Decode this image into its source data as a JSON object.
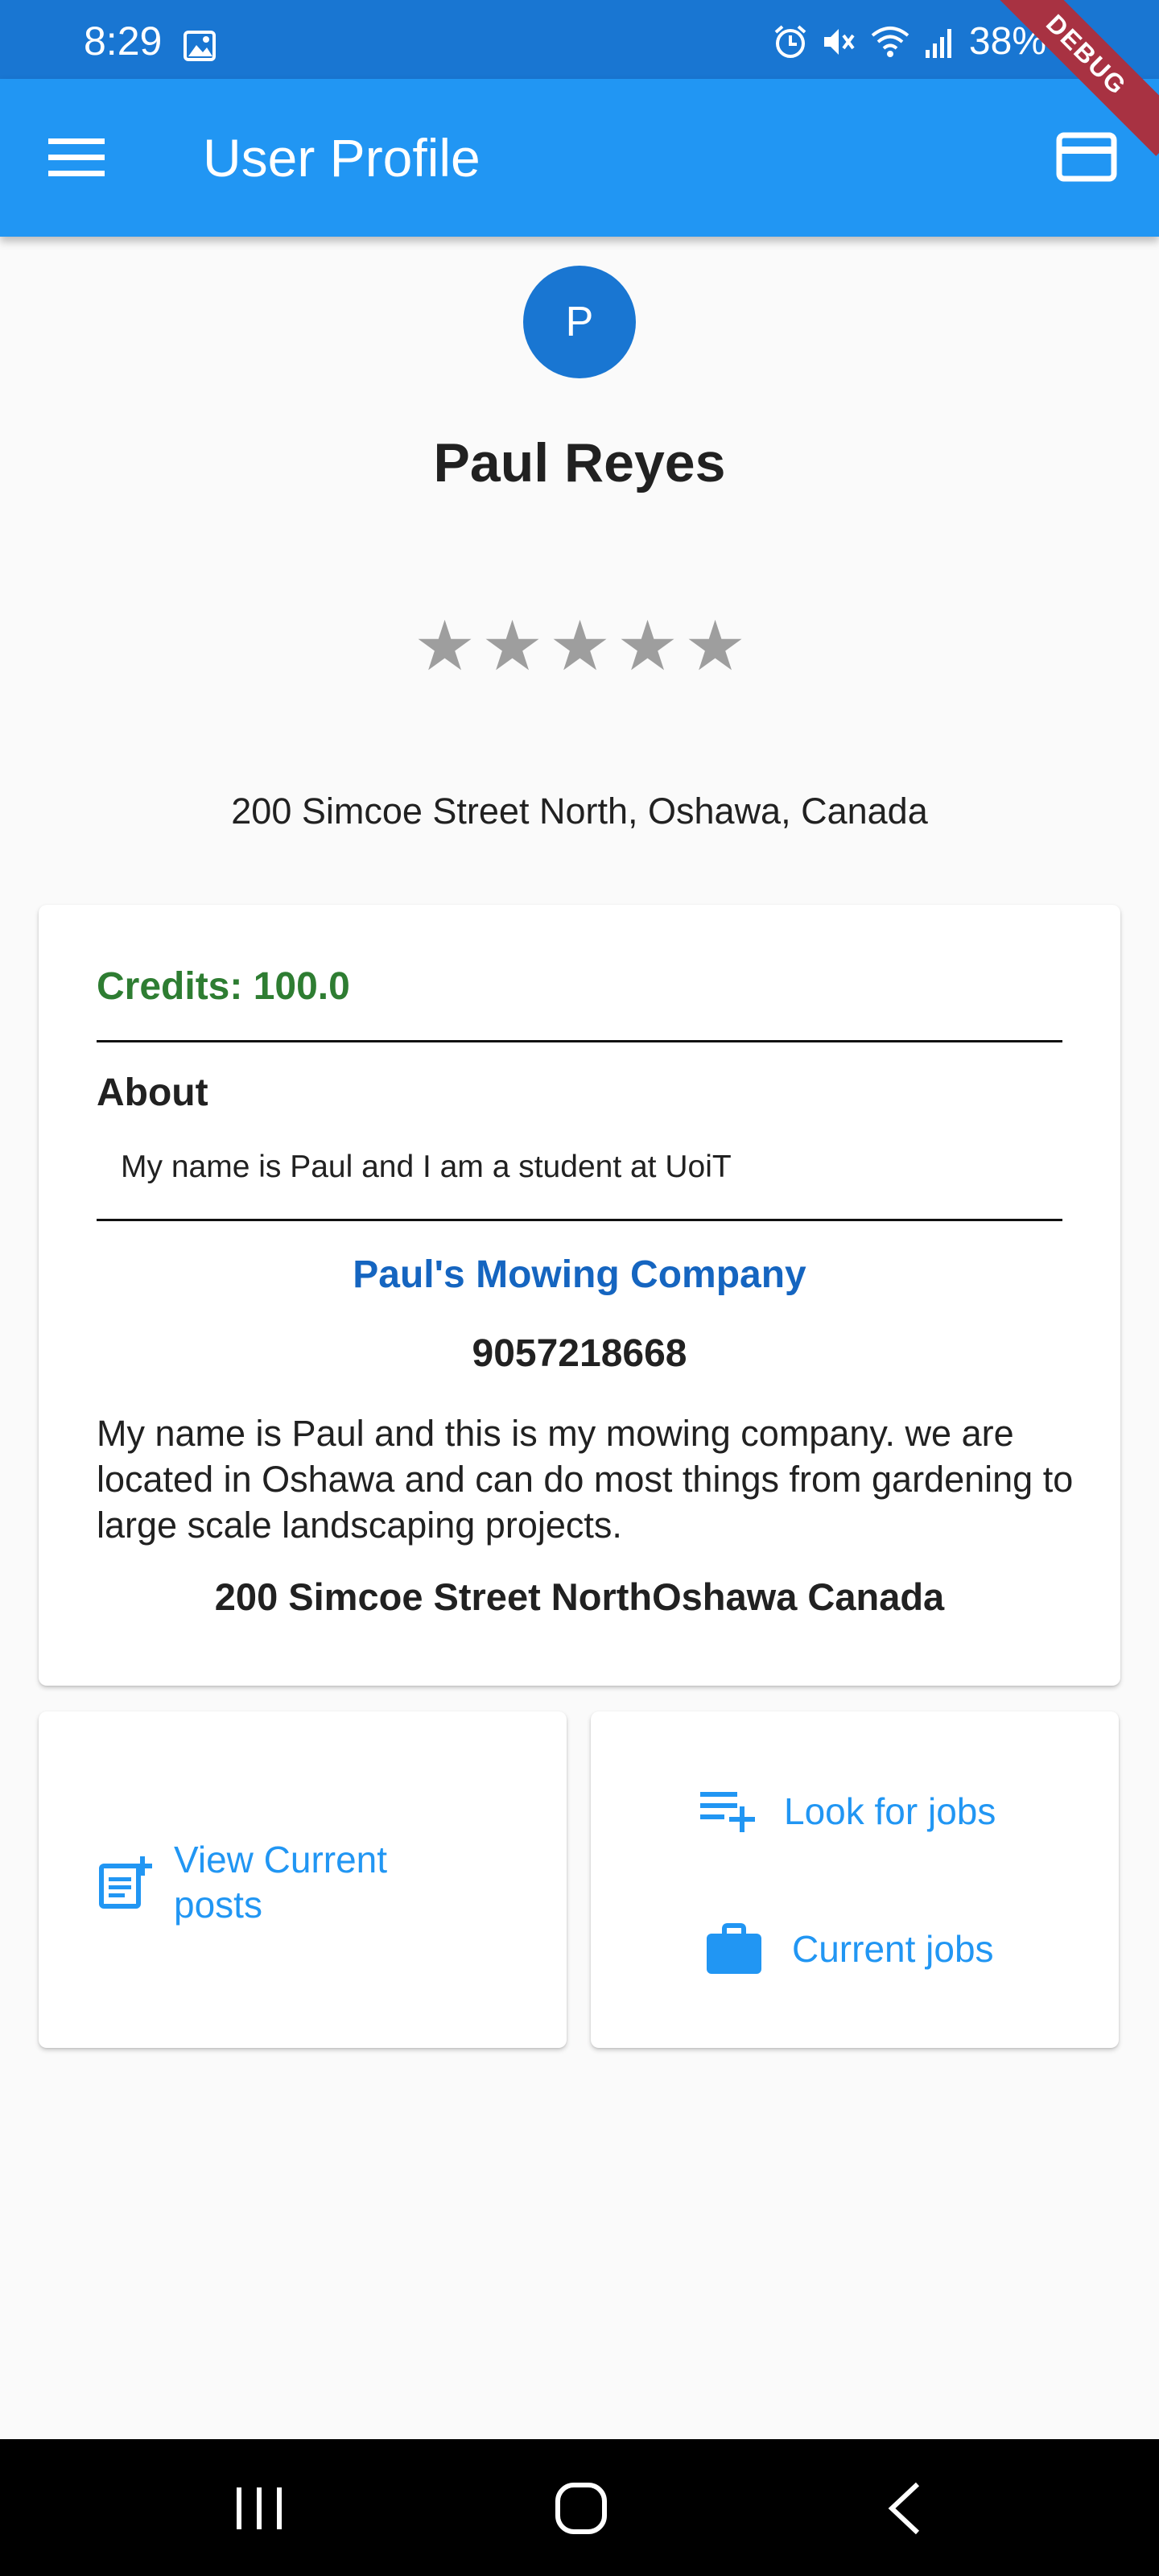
{
  "status_bar": {
    "time": "8:29",
    "battery": "38%",
    "icons": [
      "image-icon",
      "alarm-icon",
      "mute-icon",
      "wifi-icon",
      "signal-icon"
    ]
  },
  "debug_banner": "DEBUG",
  "app_bar": {
    "title": "User Profile",
    "menu_icon": "menu-icon",
    "action_icon": "credit-card-icon",
    "color": "#2196f3"
  },
  "profile": {
    "avatar_letter": "P",
    "name": "Paul Reyes",
    "rating": 0,
    "rating_max": 5,
    "address": "200 Simcoe Street North, Oshawa,  Canada"
  },
  "info_card": {
    "credits": "Credits: 100.0",
    "about_heading": "About",
    "about_text": "My name is Paul and I am a student at UoiT",
    "company_name": "Paul's Mowing Company",
    "company_phone": "9057218668",
    "company_description": "My name is Paul and this is my mowing company. we are located in Oshawa and can do most things from gardening to large scale landscaping projects.",
    "company_address": "200 Simcoe Street NorthOshawa Canada"
  },
  "actions": {
    "view_posts": "View Current posts",
    "look_for_jobs": "Look for jobs",
    "current_jobs": "Current jobs"
  },
  "nav_bar": {
    "icons": [
      "recent-apps-icon",
      "home-icon",
      "back-icon"
    ]
  },
  "colors": {
    "status_bar": "#1976d2",
    "accent": "#2196f3",
    "credits": "#2e7d32",
    "company": "#1565c0"
  }
}
